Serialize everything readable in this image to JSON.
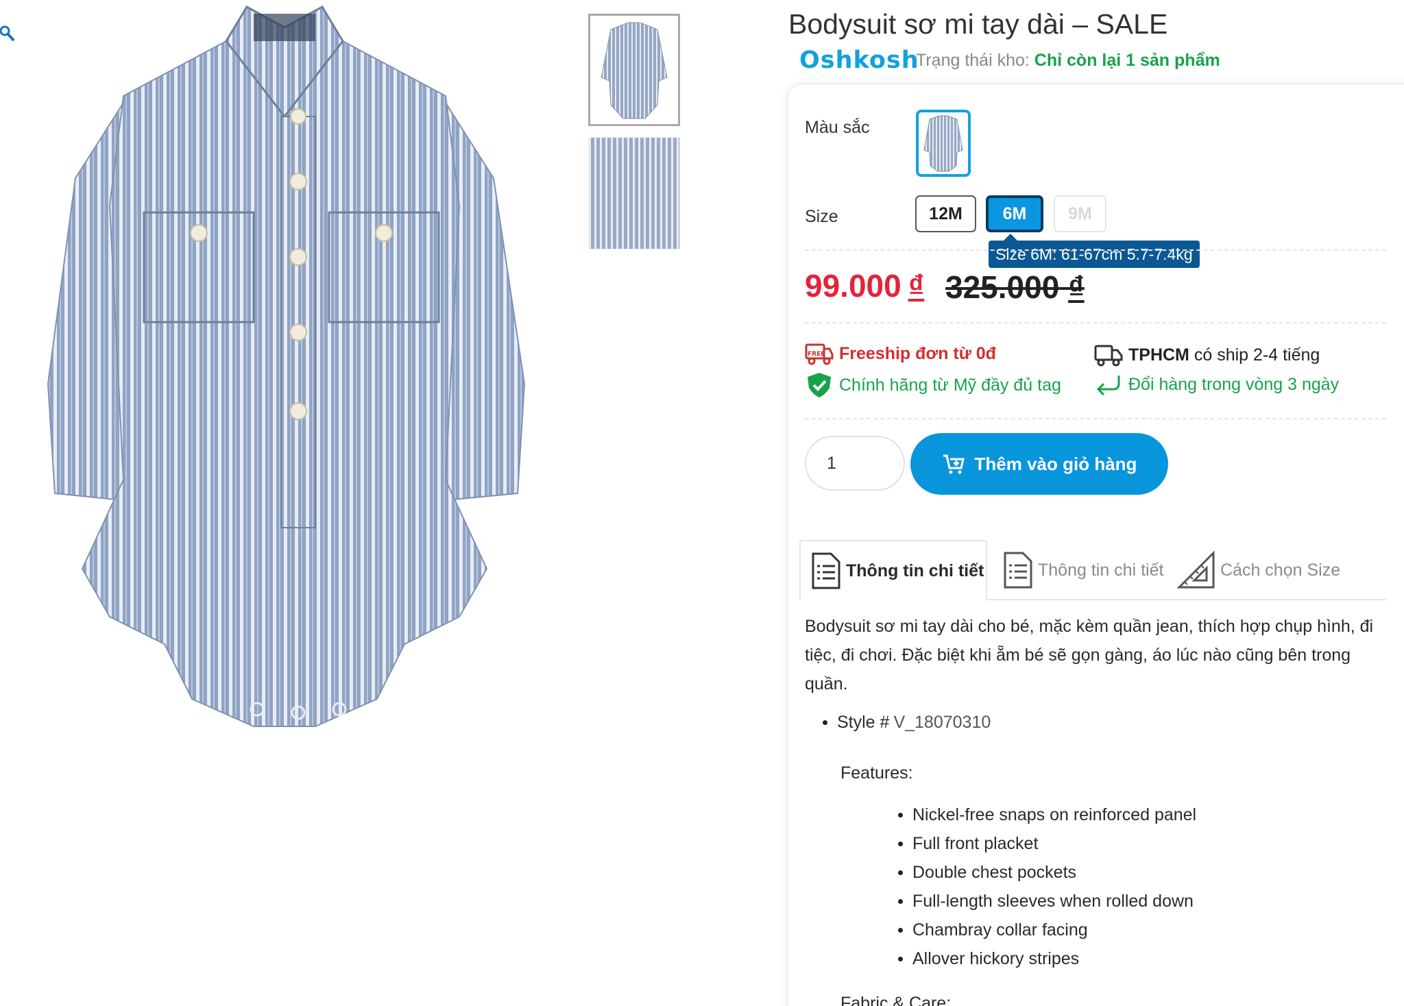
{
  "product": {
    "title": "Bodysuit sơ mi tay dài – SALE",
    "brand": "Oshkosh",
    "stock_label": "Trạng thái kho:",
    "stock_value": "Chỉ còn lại 1 sản phẩm"
  },
  "options": {
    "color_label": "Màu sắc",
    "size_label": "Size",
    "sizes": [
      {
        "label": "12M",
        "state": "available"
      },
      {
        "label": "6M",
        "state": "selected"
      },
      {
        "label": "9M",
        "state": "disabled"
      }
    ],
    "size_tooltip": "Size 6M: 61-67cm 5.7-7.4kg"
  },
  "price": {
    "current": "99.000",
    "old": "325.000",
    "currency": "₫"
  },
  "features": {
    "freeship": "Freeship đơn từ 0đ",
    "ship_city": "TPHCM",
    "ship_time": "có ship 2-4 tiếng",
    "authentic": "Chính hãng từ Mỹ đầy đủ tag",
    "exchange": "Đổi hàng trong vòng 3 ngày",
    "free_badge": "FREE"
  },
  "cart": {
    "quantity": "1",
    "add_button": "Thêm vào giỏ hàng"
  },
  "tabs": [
    {
      "label": "Thông tin chi tiết",
      "active": true
    },
    {
      "label": "Thông tin chi tiết",
      "active": false
    },
    {
      "label": "Cách chọn Size",
      "active": false
    }
  ],
  "description": {
    "intro": "Bodysuit sơ mi tay dài cho bé, mặc kèm quần jean, thích hợp chụp hình, đi tiệc, đi chơi. Đặc biệt khi ẵm bé sẽ gọn gàng, áo lúc nào cũng bên trong quần.",
    "style_label": "Style #",
    "style_value": "V_18070310",
    "features_title": "Features:",
    "features_list": [
      "Nickel-free snaps on reinforced panel",
      "Full front placket",
      "Double chest pockets",
      "Full-length sleeves when rolled down",
      "Chambray collar facing",
      "Allover hickory stripes"
    ],
    "fabric_title": "Fabric & Care:"
  },
  "colors": {
    "accent": "#0995dc",
    "sale_price": "#e3243b",
    "stock_green": "#17a34a",
    "freeship_red": "#d32f2f",
    "tooltip_bg": "#0b5894"
  }
}
